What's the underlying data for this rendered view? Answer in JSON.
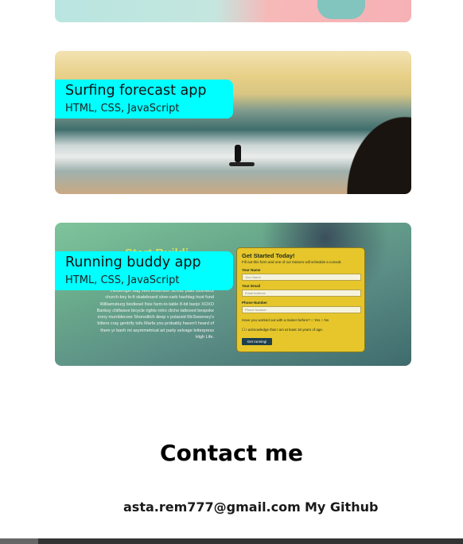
{
  "projects": [
    {
      "title": "Surfing forecast app",
      "tech": "HTML, CSS, JavaScript"
    },
    {
      "title": "Running buddy app",
      "tech": "HTML, CSS, JavaScript"
    }
  ],
  "running_preview": {
    "ghost_heading": "Start Buildi",
    "lorem": "messenger bag Wes Anderson Schlitz plaid Bushwick church-key lo-fi skateboard slow-carb hashtag trust fund Williamsburg biodiesel fixie farm-to-table 8-bit banjo XOXO Banksy chillwave bicycle rights retro cliche tattooed bespoke irony mumblecore Shoreditch deep v polaroid McSweeney's bitters cray gentrify tofu Marfa you probably haven't heard of them yr banh mi asymmetrical art party selvage letterpress High Life.",
    "form": {
      "title": "Get Started Today!",
      "subtitle": "Fill out this form and one of our trainers will schedule a consult.",
      "name_label": "Your Name",
      "name_placeholder": "Your Name",
      "email_label": "Your Email",
      "email_placeholder": "Email Address",
      "phone_label": "Phone Number",
      "phone_placeholder": "Phone Number",
      "question": "Have you worked out with a trainer before?  ○ Yes  ○ No",
      "checkbox": "☐ I acknowledge that I am at least 18 years of age.",
      "button": "Get running!"
    }
  },
  "contact": {
    "title": "Contact me",
    "email": "asta.rem777@gmail.com",
    "github": "My Github"
  },
  "colors": {
    "tag_background": "#00ffff",
    "footer": "#333333"
  }
}
